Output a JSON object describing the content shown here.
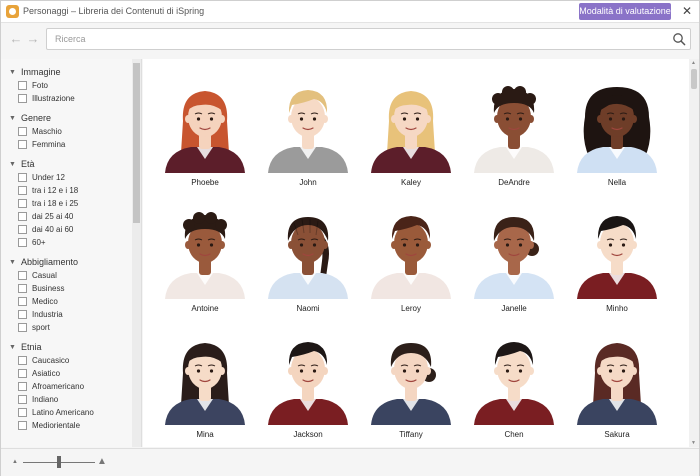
{
  "window": {
    "title": "Personaggi – Libreria dei Contenuti di iSpring",
    "mode_button": "Modalità di valutazione",
    "close_glyph": "✕"
  },
  "toolbar": {
    "back_glyph": "←",
    "forward_glyph": "→",
    "search_placeholder": "Ricerca",
    "search_value": ""
  },
  "sidebar": {
    "groups": [
      {
        "label": "Immagine",
        "options": [
          "Foto",
          "Illustrazione"
        ]
      },
      {
        "label": "Genere",
        "options": [
          "Maschio",
          "Femmina"
        ]
      },
      {
        "label": "Età",
        "options": [
          "Under 12",
          "tra i 12 e i 18",
          "tra i 18 e i 25",
          "dai 25 ai 40",
          "dai 40 ai 60",
          "60+"
        ]
      },
      {
        "label": "Abbigliamento",
        "options": [
          "Casual",
          "Business",
          "Medico",
          "Industria",
          "sport"
        ]
      },
      {
        "label": "Etnia",
        "options": [
          "Caucasico",
          "Asiatico",
          "Afroamericano",
          "Indiano",
          "Latino Americano",
          "Mediorientale"
        ]
      }
    ]
  },
  "characters": [
    {
      "name": "Phoebe",
      "hair": "#c8552f",
      "skin": "#f5d3bd",
      "shirt": "#5c1e2a",
      "style": "long"
    },
    {
      "name": "John",
      "hair": "#e3c07e",
      "skin": "#f6dac6",
      "shirt": "#9b9b9b",
      "style": "short"
    },
    {
      "name": "Kaley",
      "hair": "#e8c27a",
      "skin": "#f6d8c4",
      "shirt": "#5c1e2a",
      "style": "long"
    },
    {
      "name": "DeAndre",
      "hair": "#2a1a14",
      "skin": "#8a4e34",
      "shirt": "#eeeae6",
      "style": "curly"
    },
    {
      "name": "Nella",
      "hair": "#1e1411",
      "skin": "#6e3d28",
      "shirt": "#cfe0f3",
      "style": "big"
    },
    {
      "name": "Antoine",
      "hair": "#2b1b14",
      "skin": "#9a5a3c",
      "shirt": "#f1e8e4",
      "style": "curly"
    },
    {
      "name": "Naomi",
      "hair": "#2a1a14",
      "skin": "#8a5036",
      "shirt": "#d5e2f1",
      "style": "braid"
    },
    {
      "name": "Leroy",
      "hair": "#4a2418",
      "skin": "#9a5a3a",
      "shirt": "#f1e6e2",
      "style": "short"
    },
    {
      "name": "Janelle",
      "hair": "#3a2218",
      "skin": "#a8674a",
      "shirt": "#d4e3f4",
      "style": "bun"
    },
    {
      "name": "Minho",
      "hair": "#1a1514",
      "skin": "#f6dcc8",
      "shirt": "#7a1e22",
      "style": "short"
    },
    {
      "name": "Mina",
      "hair": "#2a1d1a",
      "skin": "#f6dcc8",
      "shirt": "#3c4460",
      "style": "long"
    },
    {
      "name": "Jackson",
      "hair": "#1d1716",
      "skin": "#f4d5bf",
      "shirt": "#7a1e22",
      "style": "short"
    },
    {
      "name": "Tiffany",
      "hair": "#2c1f1a",
      "skin": "#f4d6c2",
      "shirt": "#3a4460",
      "style": "bun"
    },
    {
      "name": "Chen",
      "hair": "#1d1716",
      "skin": "#f6dcc8",
      "shirt": "#7a1e22",
      "style": "short"
    },
    {
      "name": "Sakura",
      "hair": "#5a2a24",
      "skin": "#f5d9c6",
      "shirt": "#3a4460",
      "style": "long"
    }
  ],
  "statusbar": {
    "zoom_small_glyph": "▲",
    "zoom_large_glyph": "▲",
    "zoom_level": 0.5
  }
}
